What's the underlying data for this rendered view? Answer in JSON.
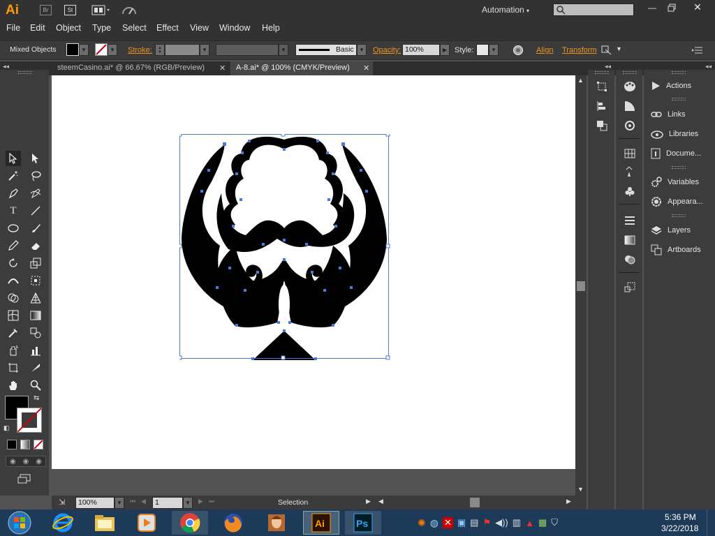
{
  "app": {
    "logo": "Ai",
    "bridge_label": "Br",
    "stock_label": "St",
    "workspace": "Automation",
    "search_placeholder": ""
  },
  "menu": [
    "File",
    "Edit",
    "Object",
    "Type",
    "Select",
    "Effect",
    "View",
    "Window",
    "Help"
  ],
  "control": {
    "selection_type": "Mixed Objects",
    "stroke_label": "Stroke:",
    "brush_profile": "Basic",
    "opacity_label": "Opacity:",
    "opacity_value": "100%",
    "style_label": "Style:",
    "align_label": "Align",
    "transform_label": "Transform"
  },
  "tabs": [
    {
      "label": "steemCasino.ai* @ 66.67% (RGB/Preview)",
      "active": false
    },
    {
      "label": "A-8.ai* @ 100% (CMYK/Preview)",
      "active": true
    }
  ],
  "status": {
    "zoom": "100%",
    "artboard_number": "1",
    "tool_name": "Selection"
  },
  "panels": [
    {
      "label": "Actions",
      "icon": "play-icon"
    },
    {
      "label": "Links",
      "icon": "link-icon"
    },
    {
      "label": "Libraries",
      "icon": "cloud-icon"
    },
    {
      "label": "Docume...",
      "icon": "document-info-icon"
    },
    {
      "label": "Variables",
      "icon": "variables-icon"
    },
    {
      "label": "Appeara...",
      "icon": "appearance-icon"
    },
    {
      "label": "Layers",
      "icon": "layers-icon"
    },
    {
      "label": "Artboards",
      "icon": "artboards-icon"
    }
  ],
  "taskbar": {
    "time": "5:36 PM",
    "date": "3/22/2018",
    "apps": [
      "windows-start",
      "internet-explorer",
      "file-explorer",
      "media-player",
      "chrome",
      "firefox",
      "image-viewer",
      "illustrator",
      "photoshop"
    ]
  },
  "colors": {
    "fill": "#000000",
    "ai_brand": "#ff9a00",
    "ps_brand": "#31a8ff",
    "selection": "#4a7bd8"
  }
}
